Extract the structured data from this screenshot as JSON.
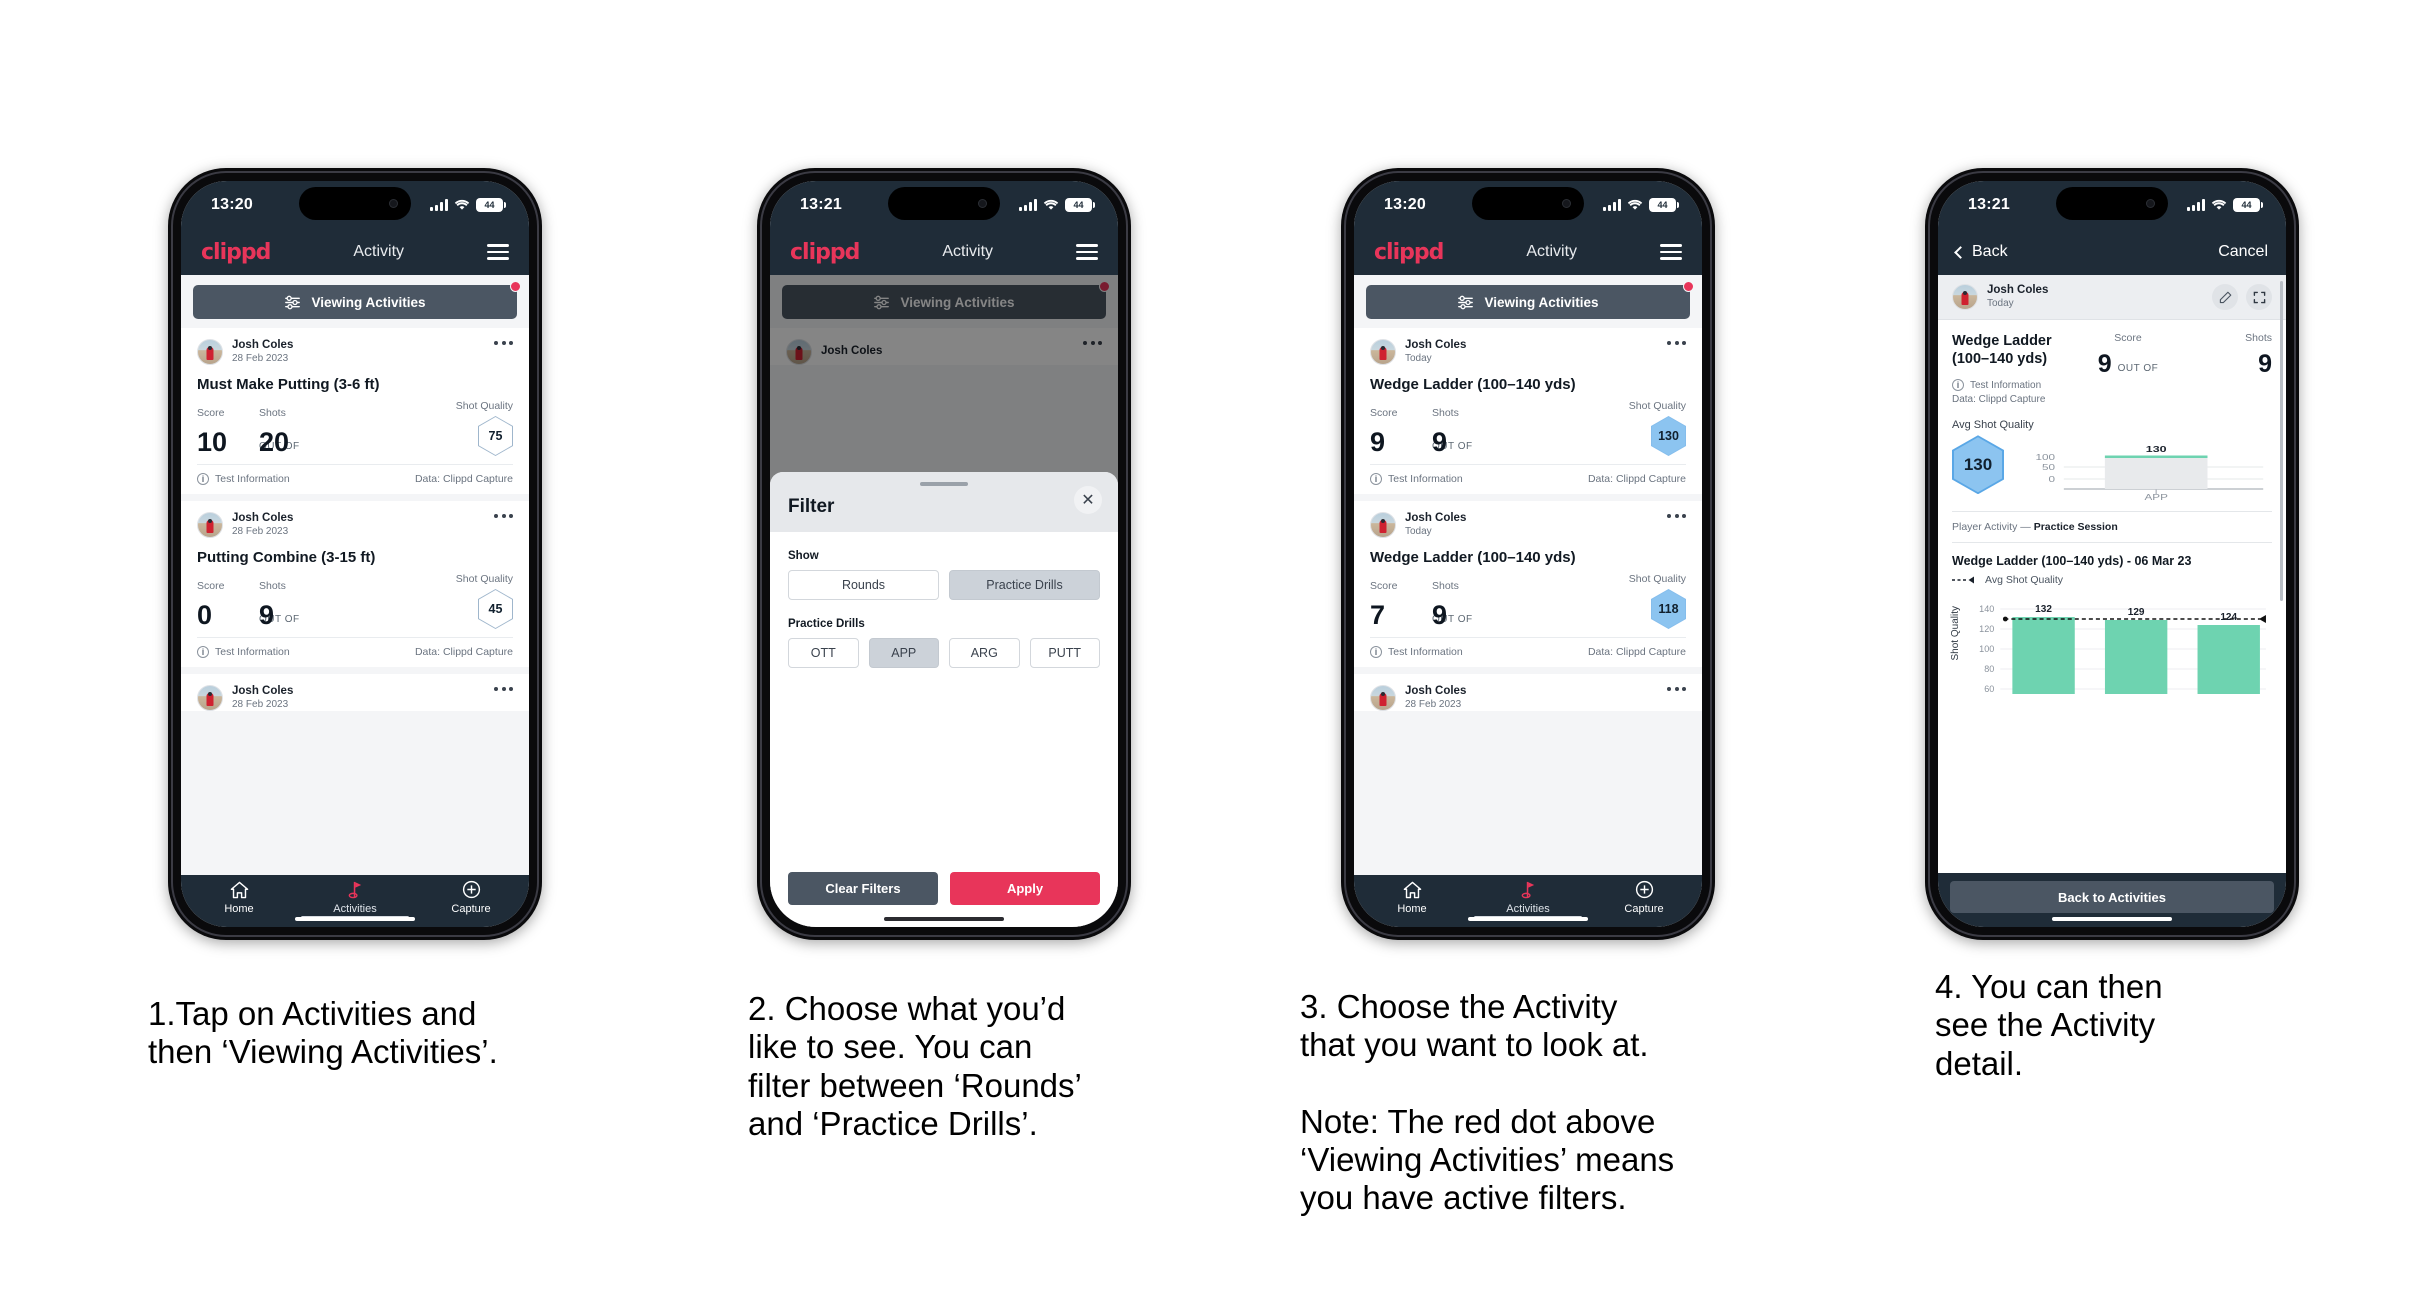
{
  "brand": {
    "logo": "clippd",
    "accent": "#e8355a",
    "dark": "#1f2c38",
    "slate": "#4b5663",
    "green": "#6ed3b0",
    "blue": "#8cc4f0"
  },
  "phones": [
    {
      "id": "phone-activities-list",
      "status": {
        "time": "13:20",
        "battery": "44"
      },
      "header": {
        "logo": "clippd",
        "title": "Activity"
      },
      "filter_button": {
        "label": "Viewing Activities",
        "has_badge": true
      },
      "cards": [
        {
          "user": "Josh Coles",
          "date": "28 Feb 2023",
          "title": "Must Make Putting (3-6 ft)",
          "score_label": "Score",
          "shots_label": "Shots",
          "quality_label": "Shot Quality",
          "score": "10",
          "outof": "OUT OF",
          "shots": "20",
          "quality": "75",
          "quality_style": "outline",
          "foot_left": "Test Information",
          "foot_right": "Data: Clippd Capture"
        },
        {
          "user": "Josh Coles",
          "date": "28 Feb 2023",
          "title": "Putting Combine (3-15 ft)",
          "score_label": "Score",
          "shots_label": "Shots",
          "quality_label": "Shot Quality",
          "score": "0",
          "outof": "OUT OF",
          "shots": "9",
          "quality": "45",
          "quality_style": "outline",
          "foot_left": "Test Information",
          "foot_right": "Data: Clippd Capture"
        }
      ],
      "partial_card": {
        "user": "Josh Coles",
        "date": "28 Feb 2023"
      },
      "tabs": [
        {
          "label": "Home",
          "icon": "home-icon",
          "active": false
        },
        {
          "label": "Activities",
          "icon": "golf-flag-icon",
          "active": true
        },
        {
          "label": "Capture",
          "icon": "plus-circle-icon",
          "active": false
        }
      ]
    },
    {
      "id": "phone-filter-modal",
      "status": {
        "time": "13:21",
        "battery": "44"
      },
      "header": {
        "logo": "clippd",
        "title": "Activity"
      },
      "filter_button": {
        "label": "Viewing Activities",
        "has_badge": true
      },
      "behind_user": "Josh Coles",
      "modal": {
        "title": "Filter",
        "close_icon": "close-icon",
        "show_label": "Show",
        "show_options": [
          {
            "label": "Rounds",
            "selected": false
          },
          {
            "label": "Practice Drills",
            "selected": true
          }
        ],
        "drills_label": "Practice Drills",
        "drill_options": [
          {
            "label": "OTT",
            "selected": false
          },
          {
            "label": "APP",
            "selected": true
          },
          {
            "label": "ARG",
            "selected": false
          },
          {
            "label": "PUTT",
            "selected": false
          }
        ],
        "clear_label": "Clear Filters",
        "apply_label": "Apply"
      }
    },
    {
      "id": "phone-activity-selected",
      "status": {
        "time": "13:20",
        "battery": "44"
      },
      "header": {
        "logo": "clippd",
        "title": "Activity"
      },
      "filter_button": {
        "label": "Viewing Activities",
        "has_badge": true
      },
      "cards": [
        {
          "user": "Josh Coles",
          "date": "Today",
          "title": "Wedge Ladder (100–140 yds)",
          "score_label": "Score",
          "shots_label": "Shots",
          "quality_label": "Shot Quality",
          "score": "9",
          "outof": "OUT OF",
          "shots": "9",
          "quality": "130",
          "quality_style": "filled",
          "foot_left": "Test Information",
          "foot_right": "Data: Clippd Capture"
        },
        {
          "user": "Josh Coles",
          "date": "Today",
          "title": "Wedge Ladder (100–140 yds)",
          "score_label": "Score",
          "shots_label": "Shots",
          "quality_label": "Shot Quality",
          "score": "7",
          "outof": "OUT OF",
          "shots": "9",
          "quality": "118",
          "quality_style": "filled",
          "foot_left": "Test Information",
          "foot_right": "Data: Clippd Capture"
        }
      ],
      "partial_card": {
        "user": "Josh Coles",
        "date": "28 Feb 2023"
      },
      "tabs": [
        {
          "label": "Home",
          "icon": "home-icon",
          "active": false
        },
        {
          "label": "Activities",
          "icon": "golf-flag-icon",
          "active": true
        },
        {
          "label": "Capture",
          "icon": "plus-circle-icon",
          "active": false
        }
      ]
    },
    {
      "id": "phone-activity-detail",
      "status": {
        "time": "13:21",
        "battery": "44"
      },
      "nav": {
        "back": "Back",
        "cancel": "Cancel"
      },
      "detail": {
        "user": "Josh Coles",
        "date": "Today",
        "edit_icon": "pencil-icon",
        "expand_icon": "expand-icon",
        "title": "Wedge Ladder\n(100–140 yds)",
        "score_label": "Score",
        "shots_label": "Shots",
        "score": "9",
        "outof": "OUT OF",
        "shots": "9",
        "test_info": "Test Information",
        "data_source": "Data: Clippd Capture",
        "avg_label": "Avg Shot Quality",
        "avg_value": "130",
        "session_prefix": "Player Activity —",
        "session_name": "Practice Session",
        "chart_title": "Wedge Ladder (100–140 yds) - 06 Mar 23",
        "legend_label": "Avg Shot Quality",
        "back_button": "Back to Activities"
      }
    }
  ],
  "chart_data": [
    {
      "type": "bar",
      "title": "Avg Shot Quality (mini)",
      "categories": [
        "APP"
      ],
      "values": [
        130
      ],
      "labels": [
        "130"
      ],
      "yticks": [
        0,
        50,
        100
      ],
      "ylim": [
        0,
        145
      ],
      "grid": true,
      "xlabel": "",
      "ylabel": ""
    },
    {
      "type": "bar",
      "title": "Wedge Ladder (100–140 yds) - 06 Mar 23",
      "categories": [
        "",
        "",
        ""
      ],
      "values": [
        132,
        129,
        124
      ],
      "labels": [
        "132",
        "129",
        "124"
      ],
      "yticks": [
        60,
        80,
        100,
        120,
        140
      ],
      "ylim": [
        50,
        145
      ],
      "ylabel": "Shot Quality",
      "xlabel": "",
      "grid": true,
      "series": [
        {
          "name": "Shot Quality",
          "values": [
            132,
            129,
            124
          ],
          "color": "#6ed3b0"
        },
        {
          "name": "Avg Shot Quality",
          "values": [
            130,
            130,
            130
          ],
          "style": "dashed",
          "color": "#111111"
        }
      ],
      "legend": [
        "Avg Shot Quality"
      ],
      "legend_position": "top-left"
    }
  ],
  "captions": [
    "1.Tap on Activities and\nthen ‘Viewing Activities’.",
    "2. Choose what you’d\nlike to see. You can\nfilter between ‘Rounds’\nand ‘Practice Drills’.",
    "3. Choose the Activity\nthat you want to look at.\n\nNote: The red dot above\n‘Viewing Activities’ means\nyou have active filters.",
    "4. You can then\nsee the Activity\ndetail."
  ]
}
